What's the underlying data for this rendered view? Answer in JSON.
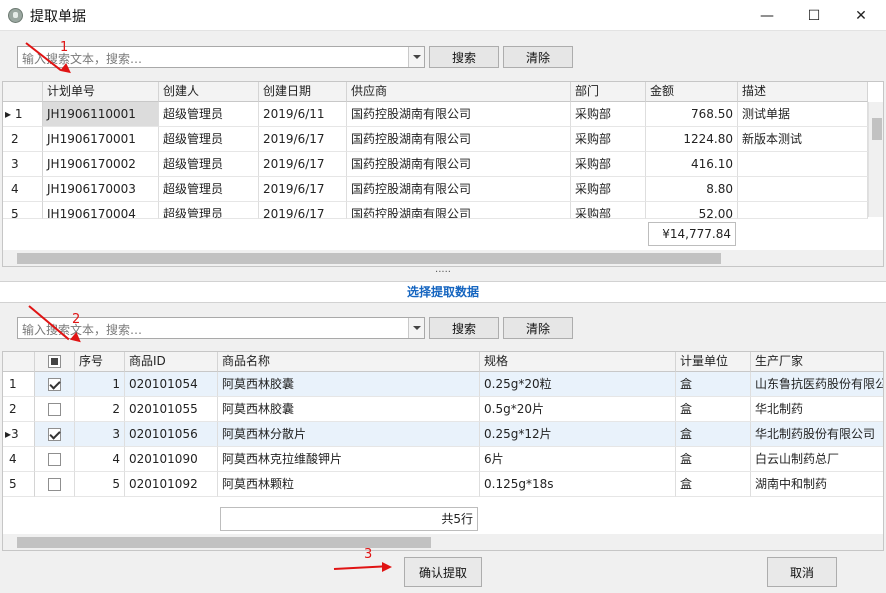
{
  "window": {
    "title": "提取单据",
    "minimize": "—",
    "maximize": "☐",
    "close": "✕"
  },
  "top": {
    "search_placeholder": "输入搜索文本，搜索…",
    "search_label": "搜索",
    "clear_label": "清除",
    "columns": [
      "计划单号",
      "创建人",
      "创建日期",
      "供应商",
      "部门",
      "金额",
      "描述"
    ],
    "rows": [
      {
        "ind": "1",
        "no": "JH1906110001",
        "creator": "超级管理员",
        "date": "2019/6/11",
        "supplier": "国药控股湖南有限公司",
        "dept": "采购部",
        "amount": "768.50",
        "desc": "测试单据"
      },
      {
        "ind": "2",
        "no": "JH1906170001",
        "creator": "超级管理员",
        "date": "2019/6/17",
        "supplier": "国药控股湖南有限公司",
        "dept": "采购部",
        "amount": "1224.80",
        "desc": "新版本测试"
      },
      {
        "ind": "3",
        "no": "JH1906170002",
        "creator": "超级管理员",
        "date": "2019/6/17",
        "supplier": "国药控股湖南有限公司",
        "dept": "采购部",
        "amount": "416.10",
        "desc": ""
      },
      {
        "ind": "4",
        "no": "JH1906170003",
        "creator": "超级管理员",
        "date": "2019/6/17",
        "supplier": "国药控股湖南有限公司",
        "dept": "采购部",
        "amount": "8.80",
        "desc": ""
      },
      {
        "ind": "5",
        "no": "JH1906170004",
        "creator": "超级管理员",
        "date": "2019/6/17",
        "supplier": "国药控股湖南有限公司",
        "dept": "采购部",
        "amount": "52.00",
        "desc": ""
      }
    ],
    "total": "¥14,777.84"
  },
  "splitter": "·····",
  "section_title": "选择提取数据",
  "bottom": {
    "search_placeholder": "输入搜索文本，搜索…",
    "search_label": "搜索",
    "clear_label": "清除",
    "columns": [
      "序号",
      "商品ID",
      "商品名称",
      "规格",
      "计量单位",
      "生产厂家"
    ],
    "rows": [
      {
        "ind": "1",
        "checked": true,
        "seq": "1",
        "id": "020101054",
        "name": "阿莫西林胶囊",
        "spec": "0.25g*20粒",
        "unit": "盒",
        "maker": "山东鲁抗医药股份有限公司"
      },
      {
        "ind": "2",
        "checked": false,
        "seq": "2",
        "id": "020101055",
        "name": "阿莫西林胶囊",
        "spec": "0.5g*20片",
        "unit": "盒",
        "maker": "华北制药"
      },
      {
        "ind": "3",
        "checked": true,
        "seq": "3",
        "id": "020101056",
        "name": "阿莫西林分散片",
        "spec": "0.25g*12片",
        "unit": "盒",
        "maker": "华北制药股份有限公司"
      },
      {
        "ind": "4",
        "checked": false,
        "seq": "4",
        "id": "020101090",
        "name": "阿莫西林克拉维酸钾片",
        "spec": "6片",
        "unit": "盒",
        "maker": "白云山制药总厂"
      },
      {
        "ind": "5",
        "checked": false,
        "seq": "5",
        "id": "020101092",
        "name": "阿莫西林颗粒",
        "spec": "0.125g*18s",
        "unit": "盒",
        "maker": "湖南中和制药"
      }
    ],
    "summary": "共5行"
  },
  "footer": {
    "confirm_label": "确认提取",
    "cancel_label": "取消"
  },
  "annotations": {
    "a1": "1",
    "a2": "2",
    "a3": "3"
  },
  "colors": {
    "accent": "#1565c0",
    "annotation": "#e01414",
    "selected_row": "#e9f2fb"
  }
}
